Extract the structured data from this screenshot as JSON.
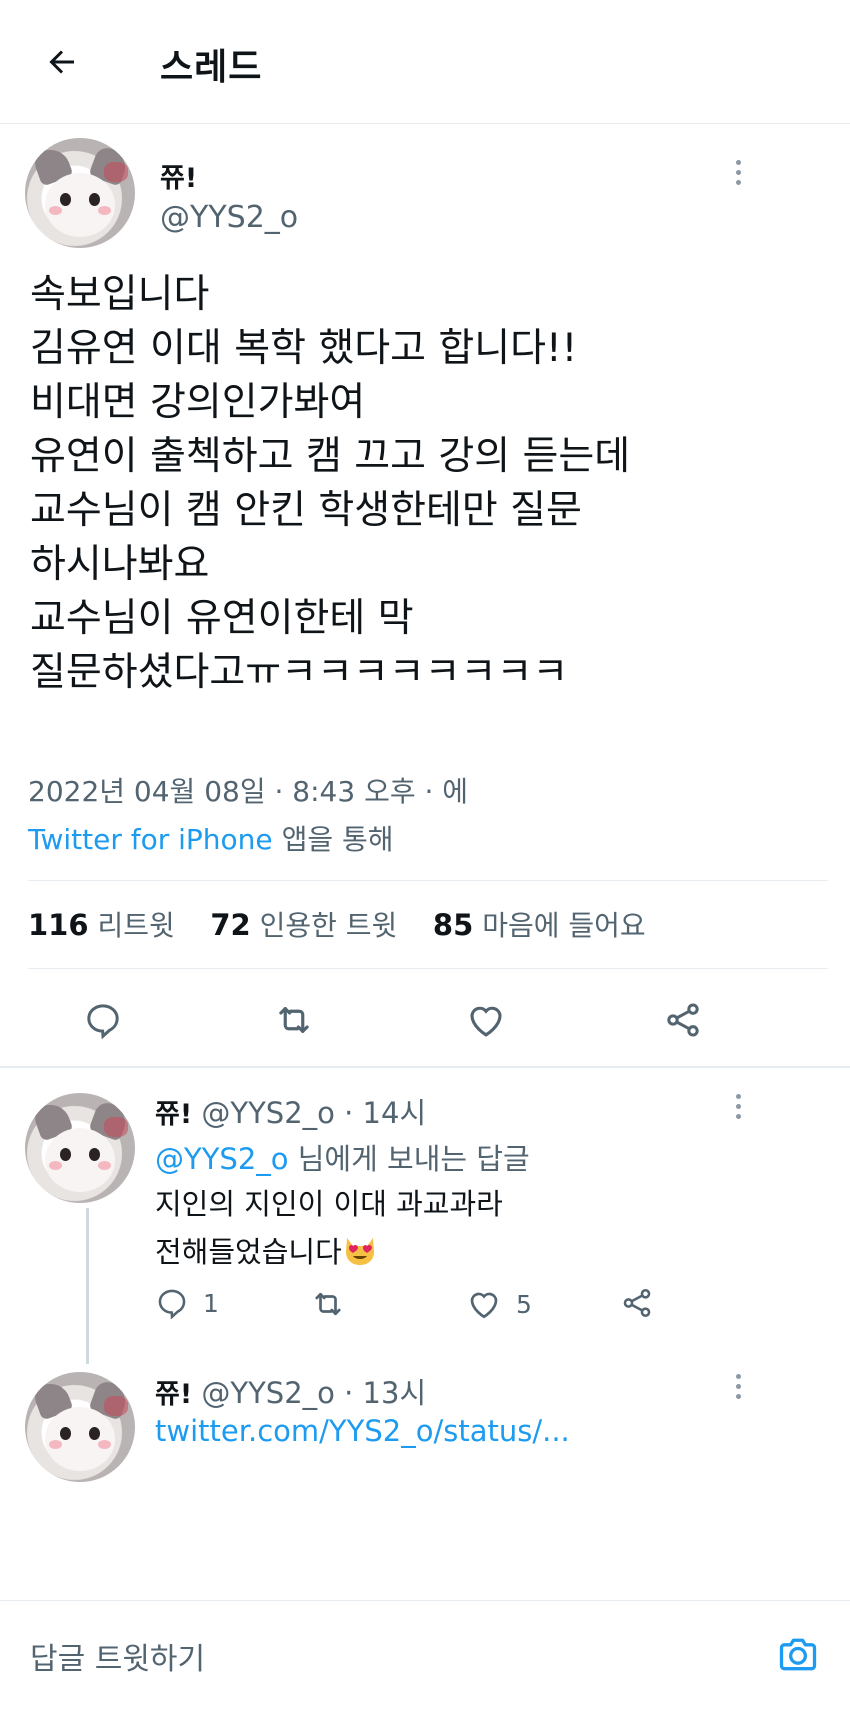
{
  "header": {
    "title": "스레드",
    "back_icon": "arrow-left-icon"
  },
  "tweet": {
    "author_name": "쮸!",
    "author_handle": "@YYS2_o",
    "lines": [
      "속보입니다",
      "김유연 이대 복학 했다고 합니다!!",
      "비대면 강의인가봐여",
      "유연이 출첵하고 캠 끄고 강의 듣는데",
      "교수님이 캠 안킨 학생한테만 질문",
      "하시나봐요",
      "교수님이 유연이한테 막",
      "질문하셨다고ㅠㅋㅋㅋㅋㅋㅋㅋㅋ"
    ],
    "timestamp": "2022년 04월 08일 · 8:43 오후 · 에",
    "source_app": "Twitter for iPhone",
    "source_suffix": "앱을 통해",
    "stats": {
      "retweets": "116",
      "retweets_label": "리트윗",
      "quotes": "72",
      "quotes_label": "인용한 트윗",
      "likes": "85",
      "likes_label": "마음에 들어요"
    }
  },
  "replies": [
    {
      "author_name": "쮸!",
      "author_handle": "@YYS2_o",
      "time": "· 14시",
      "reply_to_handle": "@YYS2_o",
      "reply_to_suffix": "님에게 보내는 답글",
      "line1": "지인의 지인이 이대 과교과라",
      "line2": "전해들었습니다",
      "reply_count": "1",
      "like_count": "5"
    },
    {
      "author_name": "쮸!",
      "author_handle": "@YYS2_o",
      "time": "· 13시",
      "link_text": "twitter.com/YYS2_o/status/..."
    }
  ],
  "composer": {
    "placeholder": "답글 트윗하기",
    "camera_icon": "camera-icon"
  },
  "colors": {
    "accent": "#1d9bf0",
    "secondary_text": "#536471",
    "divider": "#e6ecf0"
  }
}
